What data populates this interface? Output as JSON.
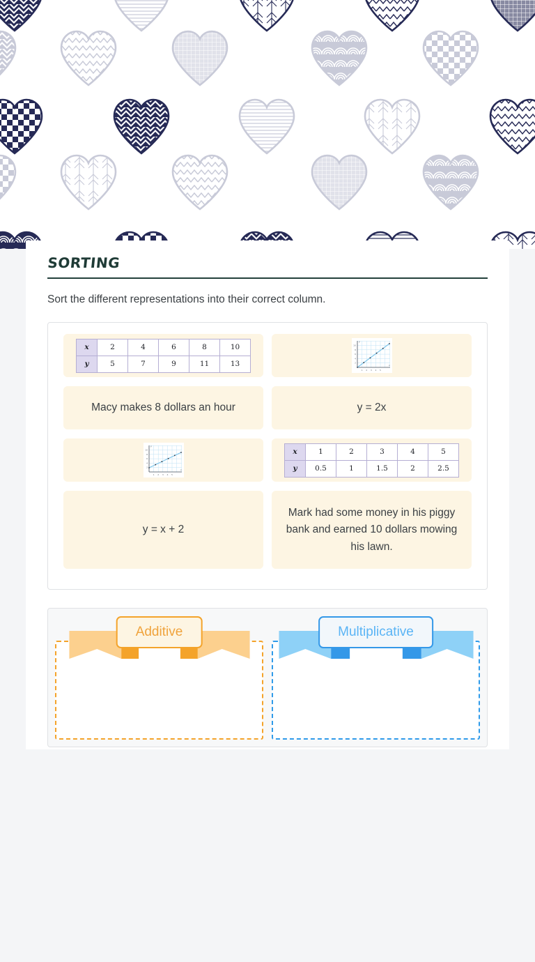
{
  "header": {
    "pattern_name": "hearts-pattern",
    "colors": {
      "navy": "#262a56",
      "light": "#c8cad8"
    }
  },
  "section": {
    "title": "SORTING",
    "instructions": "Sort the different representations into their correct column."
  },
  "items": [
    {
      "id": "item-table-1",
      "type": "table",
      "table": {
        "x_label": "x",
        "y_label": "y",
        "x_values": [
          "2",
          "4",
          "6",
          "8",
          "10"
        ],
        "y_values": [
          "5",
          "7",
          "9",
          "11",
          "13"
        ]
      }
    },
    {
      "id": "item-graph-1",
      "type": "graph",
      "graph_name": "line-graph-through-origin"
    },
    {
      "id": "item-text-1",
      "type": "text",
      "text": "Macy makes 8 dollars an hour"
    },
    {
      "id": "item-equation-1",
      "type": "text",
      "text": "y = 2x"
    },
    {
      "id": "item-graph-2",
      "type": "graph",
      "graph_name": "line-graph-with-intercept"
    },
    {
      "id": "item-table-2",
      "type": "table",
      "table": {
        "x_label": "x",
        "y_label": "y",
        "x_values": [
          "1",
          "2",
          "3",
          "4",
          "5"
        ],
        "y_values": [
          "0.5",
          "1",
          "1.5",
          "2",
          "2.5"
        ]
      }
    },
    {
      "id": "item-equation-2",
      "type": "text",
      "text": "y = x + 2"
    },
    {
      "id": "item-text-2",
      "type": "text",
      "text": "Mark had some money in his piggy bank and earned 10 dollars mowing his lawn."
    }
  ],
  "dropzones": [
    {
      "id": "dropzone-additive",
      "label": "Additive",
      "color": "#f4a32a",
      "contents": []
    },
    {
      "id": "dropzone-multiplicative",
      "label": "Multiplicative",
      "color": "#2f9bea",
      "contents": []
    }
  ]
}
